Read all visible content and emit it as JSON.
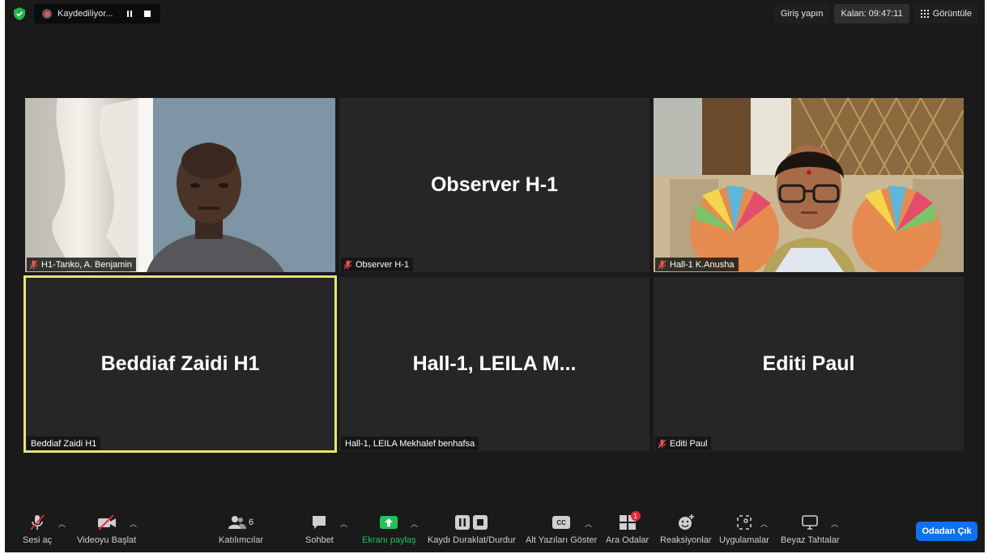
{
  "recording": {
    "label": "Kaydediliyor..."
  },
  "topbar": {
    "sign_in": "Giriş yapın",
    "timer": "Kalan: 09:47:11",
    "view": "Görüntüle"
  },
  "tiles": [
    {
      "name": "H1-Tanko, A. Benjamin",
      "muted": true,
      "video": true
    },
    {
      "name": "Observer H-1",
      "display": "Observer H-1",
      "muted": true,
      "video": false
    },
    {
      "name": "Hall-1 K.Anusha",
      "muted": true,
      "video": true
    },
    {
      "name": "Beddiaf Zaidi H1",
      "display": "Beddiaf Zaidi H1",
      "muted": false,
      "video": false,
      "active_speaker": true
    },
    {
      "name": "Hall-1, LEILA Mekhalef benhafsa",
      "display": "Hall-1, LEILA M...",
      "muted": false,
      "video": false
    },
    {
      "name": "Editi Paul",
      "display": "Editi Paul",
      "muted": true,
      "video": false
    }
  ],
  "toolbar": {
    "unmute": "Sesi aç",
    "start_video": "Videoyu Başlat",
    "participants": "Katılımcılar",
    "participants_count": "6",
    "chat": "Sohbet",
    "share_screen": "Ekranı paylaş",
    "record": "Kaydı Duraklat/Durdur",
    "captions": "Alt Yazıları Göster",
    "cc": "CC",
    "breakout": "Ara Odalar",
    "breakout_badge": "1",
    "reactions": "Reaksiyonlar",
    "apps": "Uygulamalar",
    "whiteboards": "Beyaz Tahtalar",
    "leave": "Odadan Çık"
  },
  "colors": {
    "accent_green": "#25c25a",
    "leave_blue": "#0e72ed",
    "active_border": "#e8e573",
    "mute_red": "#e8554e"
  }
}
